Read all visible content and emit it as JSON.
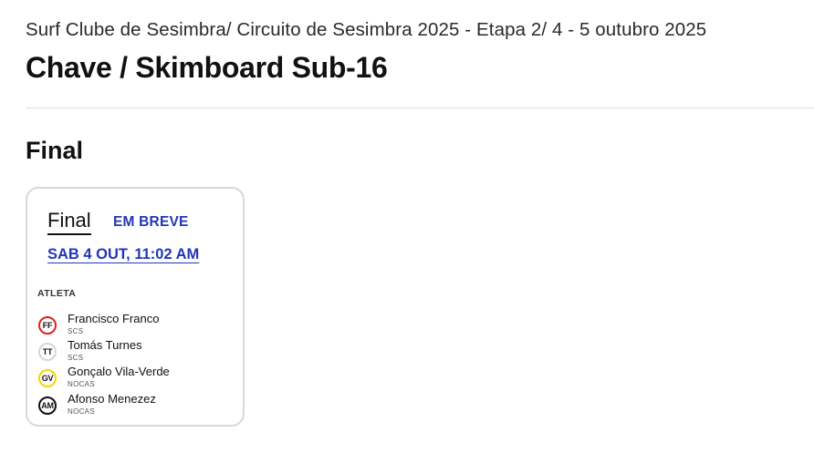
{
  "event": {
    "subtitle": "Surf Clube de Sesimbra/ Circuito de Sesimbra 2025 - Etapa 2/ 4 - 5 outubro 2025",
    "title": "Chave / Skimboard Sub-16"
  },
  "round": {
    "title": "Final"
  },
  "heat": {
    "name": "Final",
    "status": "EM BREVE",
    "datetime": "SAB 4 OUT, 11:02 AM",
    "column_header": "ATLETA",
    "athletes": [
      {
        "initials": "FF",
        "name": "Francisco Franco",
        "club": "SCS",
        "color": "#e0201c",
        "fill": "#ffffff"
      },
      {
        "initials": "TT",
        "name": "Tomás Turnes",
        "club": "SCS",
        "color": "#d6d6d6",
        "fill": "#ffffff"
      },
      {
        "initials": "GV",
        "name": "Gonçalo Vila-Verde",
        "club": "NOCAS",
        "color": "#f2d600",
        "fill": "#ffffff"
      },
      {
        "initials": "AM",
        "name": "Afonso Menezez",
        "club": "NOCAS",
        "color": "#111111",
        "fill": "#ffffff"
      }
    ]
  }
}
